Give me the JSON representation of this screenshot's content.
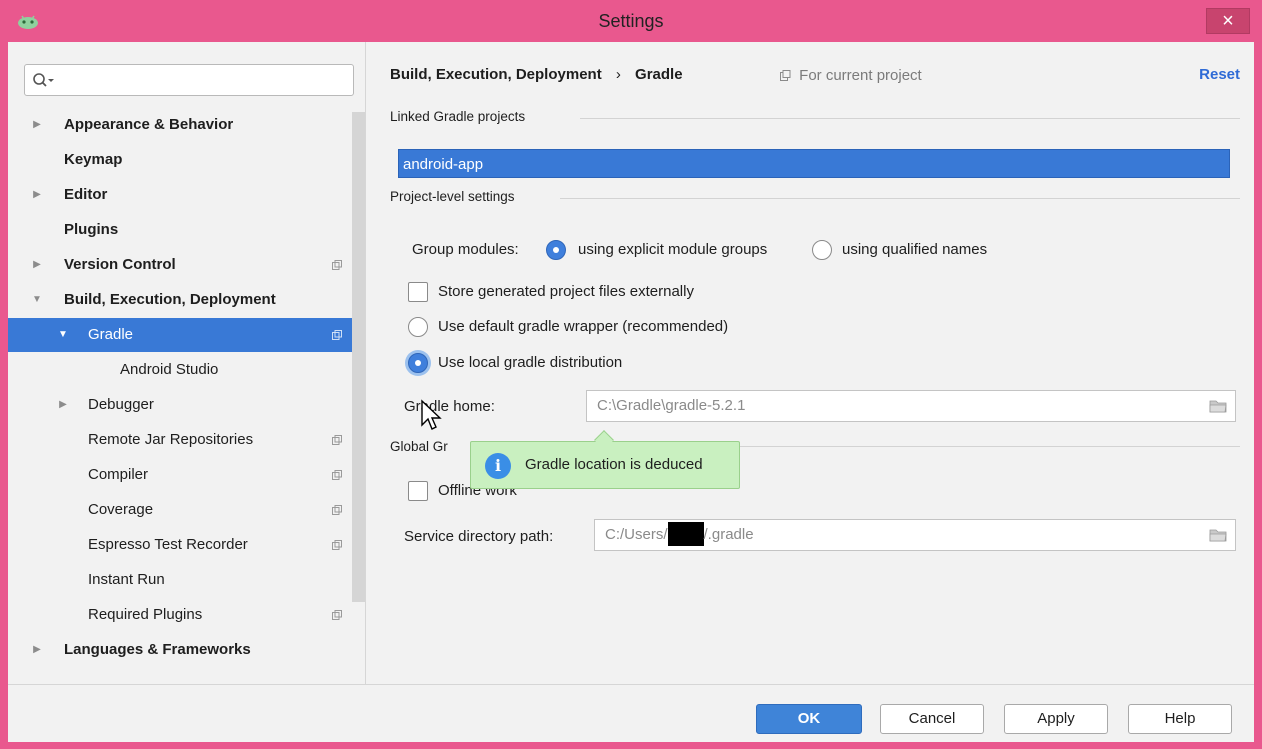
{
  "window": {
    "title": "Settings",
    "close_glyph": "×",
    "colors": {
      "titlebar": "#e9588e",
      "selection": "#3979d6",
      "link": "#2f6bd6"
    }
  },
  "sidebar": {
    "search": {
      "value": "",
      "icon": "search-icon"
    },
    "items": [
      {
        "label": "Appearance & Behavior",
        "bold": true,
        "arrow": "▶",
        "indent": 0,
        "proj": false
      },
      {
        "label": "Keymap",
        "bold": true,
        "arrow": "",
        "indent": 0,
        "proj": false
      },
      {
        "label": "Editor",
        "bold": true,
        "arrow": "▶",
        "indent": 0,
        "proj": false
      },
      {
        "label": "Plugins",
        "bold": true,
        "arrow": "",
        "indent": 0,
        "proj": false
      },
      {
        "label": "Version Control",
        "bold": true,
        "arrow": "▶",
        "indent": 0,
        "proj": true
      },
      {
        "label": "Build, Execution, Deployment",
        "bold": true,
        "arrow": "▼",
        "indent": 0,
        "proj": false
      },
      {
        "label": "Gradle",
        "bold": false,
        "arrow": "▼",
        "indent": 1,
        "proj": true,
        "selected": true
      },
      {
        "label": "Android Studio",
        "bold": false,
        "arrow": "",
        "indent": 2,
        "proj": false
      },
      {
        "label": "Debugger",
        "bold": false,
        "arrow": "▶",
        "indent": 1,
        "proj": false
      },
      {
        "label": "Remote Jar Repositories",
        "bold": false,
        "arrow": "",
        "indent": 1,
        "proj": true
      },
      {
        "label": "Compiler",
        "bold": false,
        "arrow": "",
        "indent": 1,
        "proj": true
      },
      {
        "label": "Coverage",
        "bold": false,
        "arrow": "",
        "indent": 1,
        "proj": true
      },
      {
        "label": "Espresso Test Recorder",
        "bold": false,
        "arrow": "",
        "indent": 1,
        "proj": true
      },
      {
        "label": "Instant Run",
        "bold": false,
        "arrow": "",
        "indent": 1,
        "proj": false
      },
      {
        "label": "Required Plugins",
        "bold": false,
        "arrow": "",
        "indent": 1,
        "proj": true
      },
      {
        "label": "Languages & Frameworks",
        "bold": true,
        "arrow": "▶",
        "indent": 0,
        "proj": false
      }
    ]
  },
  "header": {
    "breadcrumb_parent": "Build, Execution, Deployment",
    "breadcrumb_sep": "›",
    "breadcrumb_current": "Gradle",
    "for_current_project": "For current project",
    "reset": "Reset"
  },
  "linked": {
    "title": "Linked Gradle projects",
    "projects": [
      "android-app"
    ]
  },
  "project_level": {
    "title": "Project-level settings",
    "group_modules_label": "Group modules:",
    "group_option_explicit": "using explicit module groups",
    "group_option_qualified": "using qualified names",
    "group_selected": "explicit",
    "store_external_label": "Store generated project files externally",
    "store_external_checked": false,
    "wrapper_label": "Use default gradle wrapper (recommended)",
    "local_label": "Use local gradle distribution",
    "distribution_selected": "local",
    "gradle_home_label": "Gradle home:",
    "gradle_home_value": "C:\\Gradle\\gradle-5.2.1"
  },
  "global": {
    "title_visible": "Global Gr",
    "offline_label_visible": "Offline work",
    "offline_checked": false,
    "service_dir_label": "Service directory path:",
    "service_dir_prefix": "C:/Users/",
    "service_dir_suffix": "/.gradle"
  },
  "tooltip": {
    "text": "Gradle location is deduced",
    "icon": "info-icon"
  },
  "footer": {
    "ok": "OK",
    "cancel": "Cancel",
    "apply": "Apply",
    "help": "Help"
  }
}
